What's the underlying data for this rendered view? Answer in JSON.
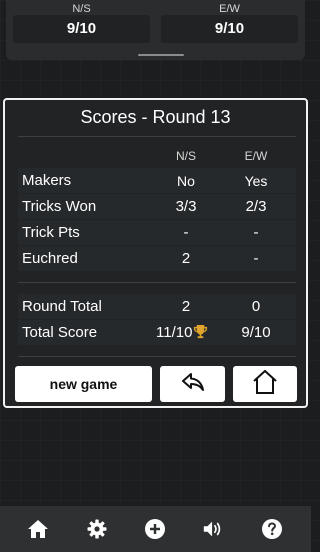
{
  "top": {
    "ns": {
      "label": "N/S",
      "value": "9/10"
    },
    "ew": {
      "label": "E/W",
      "value": "9/10"
    }
  },
  "card": {
    "title": "Scores - Round 13",
    "col_ns": "N/S",
    "col_ew": "E/W",
    "rows": [
      {
        "label": "Makers",
        "ns": "No",
        "ew": "Yes"
      },
      {
        "label": "Tricks Won",
        "ns": "3/3",
        "ew": "2/3"
      },
      {
        "label": "Trick Pts",
        "ns": "-",
        "ew": "-"
      },
      {
        "label": "Euchred",
        "ns": "2",
        "ew": "-"
      }
    ],
    "totals": [
      {
        "label": "Round Total",
        "ns": "2",
        "ew": "0"
      },
      {
        "label": "Total Score",
        "ns": "11/10",
        "ew": "9/10"
      }
    ],
    "trophy_color": "#e0a52a"
  },
  "buttons": {
    "new_game": "new game",
    "back_icon": "undo-arrow-icon",
    "home_icon": "home-icon"
  },
  "nav": [
    "home-icon",
    "gear-icon",
    "plus-circle-icon",
    "speaker-icon",
    "help-icon"
  ]
}
